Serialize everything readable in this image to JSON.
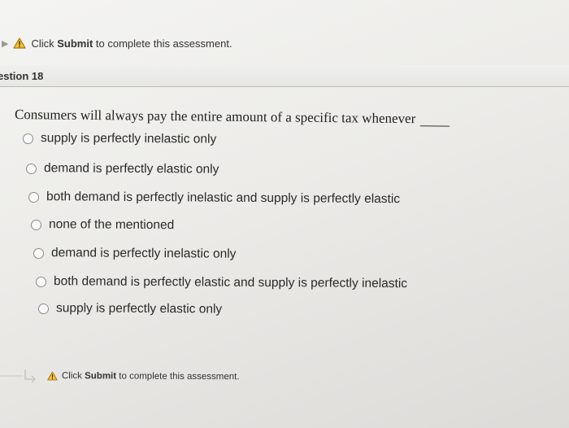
{
  "warning_top": {
    "icon": "warning-triangle-icon",
    "prefix": "Click ",
    "bold": "Submit",
    "suffix": " to complete this assessment."
  },
  "question_header": {
    "label": "estion 18"
  },
  "question": {
    "text": "Consumers will always pay the entire amount of a specific tax whenever"
  },
  "options": [
    {
      "label": "supply is perfectly inelastic only"
    },
    {
      "label": "demand is perfectly elastic only"
    },
    {
      "label": "both demand is perfectly inelastic and supply is perfectly elastic"
    },
    {
      "label": "none of the mentioned"
    },
    {
      "label": "demand is perfectly inelastic only"
    },
    {
      "label": "both demand is perfectly elastic and supply is perfectly inelastic"
    },
    {
      "label": "supply is perfectly elastic only"
    }
  ],
  "warning_bottom": {
    "icon": "warning-triangle-icon",
    "prefix": "Click ",
    "bold": "Submit",
    "suffix": " to complete this assessment."
  },
  "colors": {
    "warning_fill": "#f2c230",
    "warning_stroke": "#a8741a",
    "radio_border": "#8a8a8a"
  }
}
